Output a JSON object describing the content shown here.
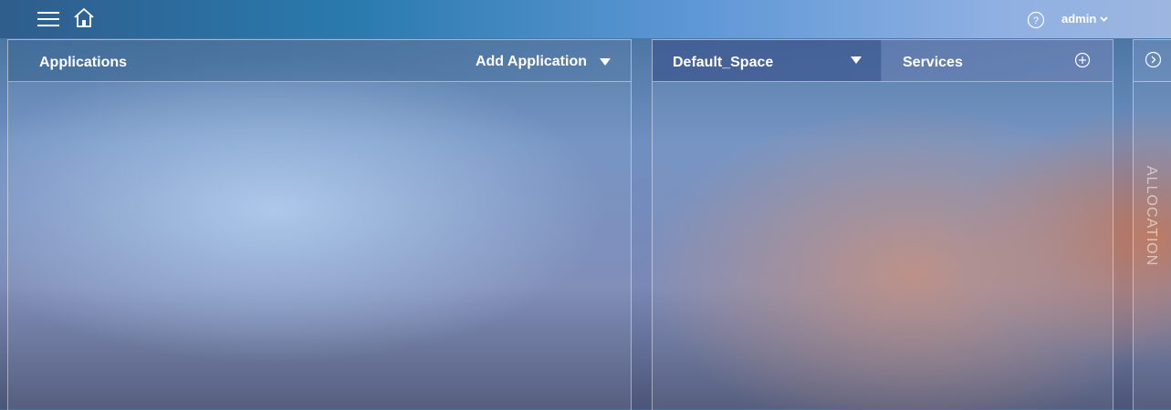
{
  "header": {
    "user_label": "admin"
  },
  "applications_panel": {
    "title": "Applications",
    "add_label": "Add Application"
  },
  "space_panel": {
    "selected_space": "Default_Space",
    "services_title": "Services"
  },
  "allocation_panel": {
    "label": "ALLOCATION"
  },
  "icons": [
    "hamburger-menu-icon",
    "home-icon",
    "help-icon",
    "chevron-down-icon",
    "plus-circle-icon",
    "chevron-right-circle-icon"
  ]
}
